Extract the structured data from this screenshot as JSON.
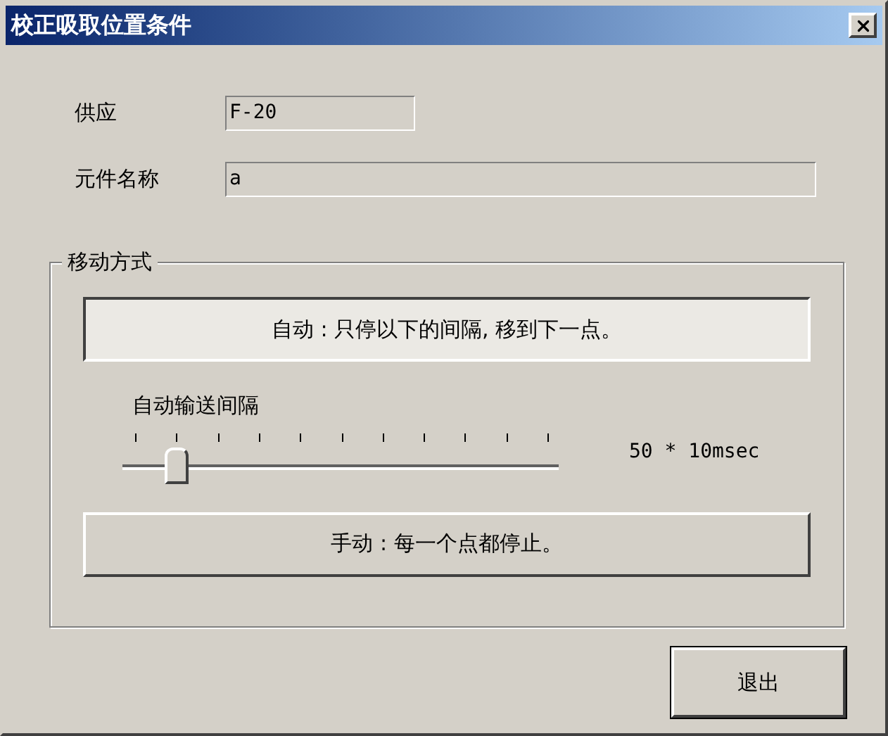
{
  "window": {
    "title": "校正吸取位置条件"
  },
  "fields": [
    {
      "label": "供应",
      "value": "F-20"
    },
    {
      "label": "元件名称",
      "value": "a"
    }
  ],
  "move_mode": {
    "title": "移动方式",
    "modes": [
      {
        "label": "自动 : 只停以下的间隔, 移到下一点。",
        "selected": true,
        "kind": "auto"
      },
      {
        "label": "手动 : 每一个点都停止。",
        "selected": false,
        "kind": "manual"
      }
    ],
    "interval": {
      "label": "自动输送间隔",
      "level": 0.1,
      "reading": "50 * 10msec"
    }
  },
  "buttons": [
    "退出"
  ]
}
